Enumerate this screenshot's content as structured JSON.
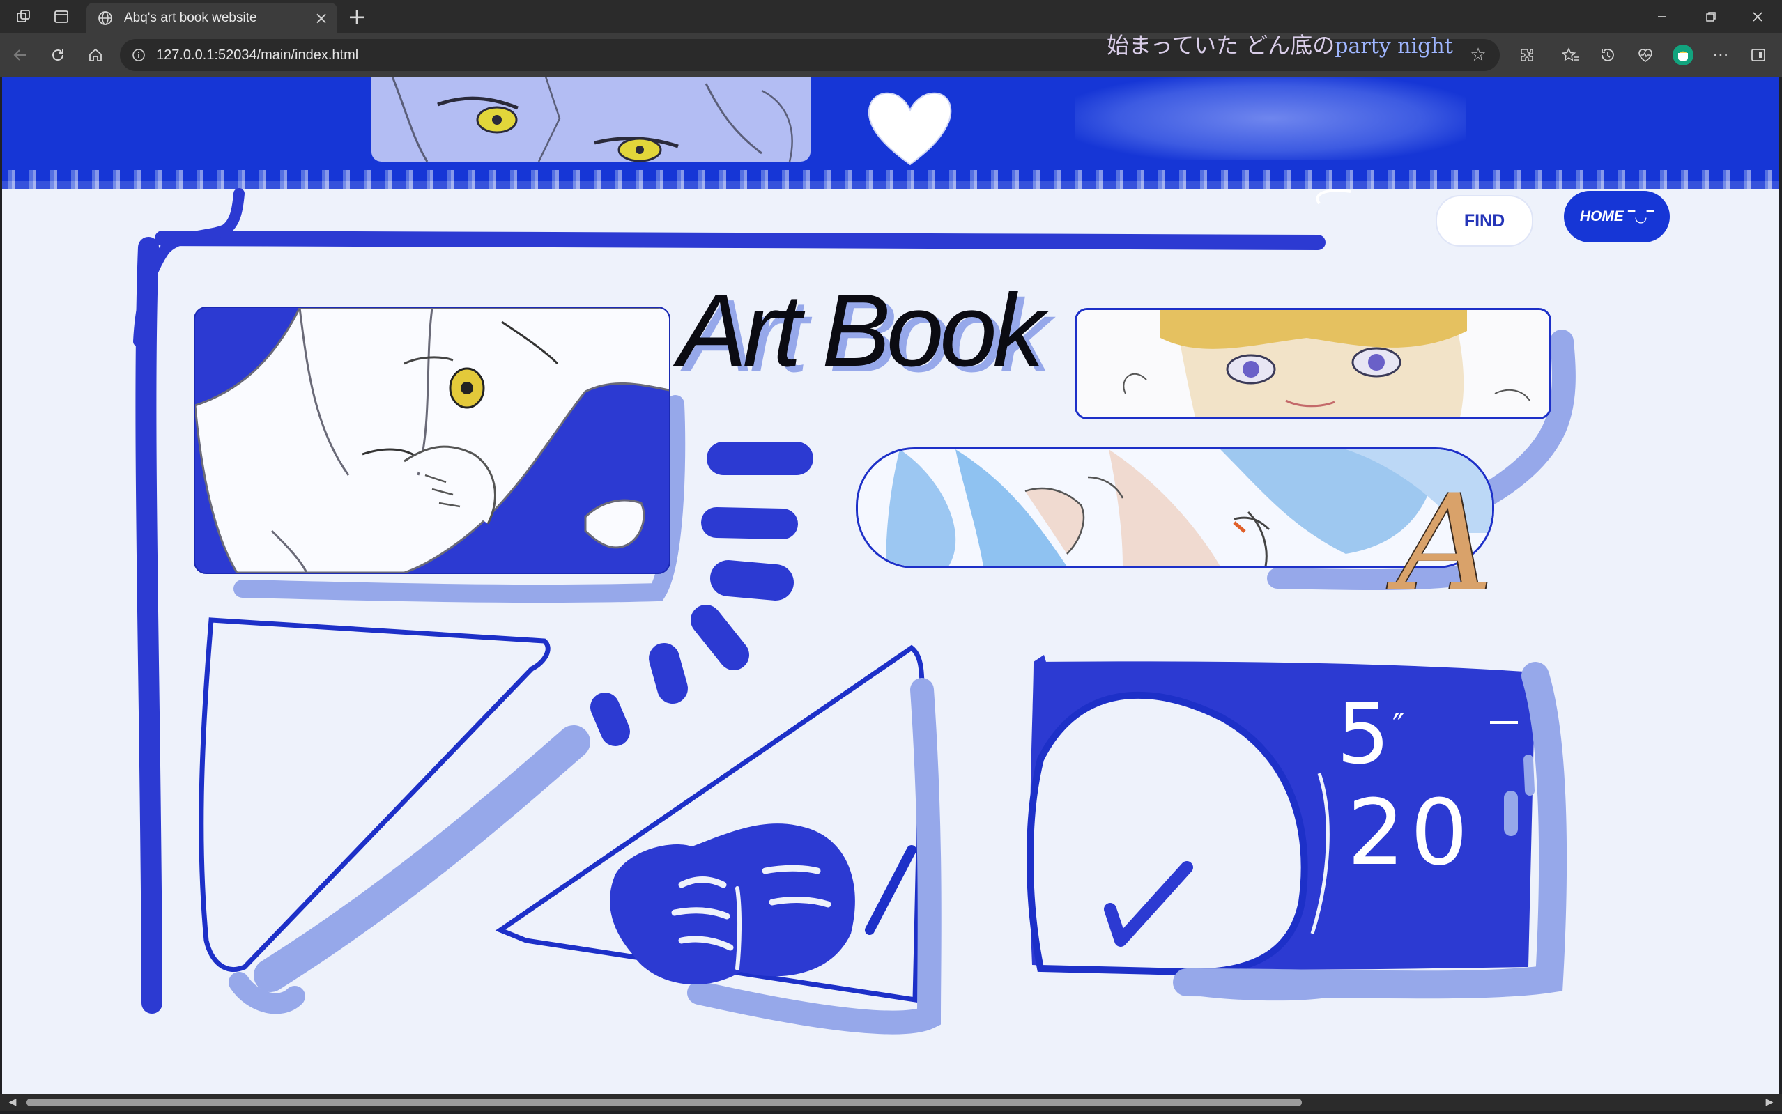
{
  "browser": {
    "tab_title": "Abq's art book website",
    "url": "127.0.0.1:52034/main/index.html",
    "close_glyph": "×",
    "new_tab_glyph": "+",
    "lyric_jp": "始まっていた どん底の",
    "lyric_latin": "party night"
  },
  "page": {
    "nav": {
      "find_label": "FIND",
      "home_label": "HOME"
    },
    "title": "Art Book",
    "signature": "A",
    "board_text_1": "5",
    "board_text_2": "20",
    "colors": {
      "primary": "#1636d6",
      "light": "#96a8ea",
      "background": "#eef2fb",
      "signature": "#d9a26a"
    }
  },
  "icons": [
    "workspaces-icon",
    "tab-actions-icon",
    "globe-icon",
    "close-icon",
    "plus-icon",
    "minimize-icon",
    "restore-icon",
    "window-close-icon",
    "back-icon",
    "refresh-icon",
    "home-icon",
    "info-icon",
    "favorite-star-icon",
    "extensions-icon",
    "favorites-icon",
    "history-icon",
    "health-icon",
    "profile-icon",
    "more-icon",
    "sidebar-icon",
    "heart-icon",
    "checkmark-icon",
    "book-icon"
  ]
}
